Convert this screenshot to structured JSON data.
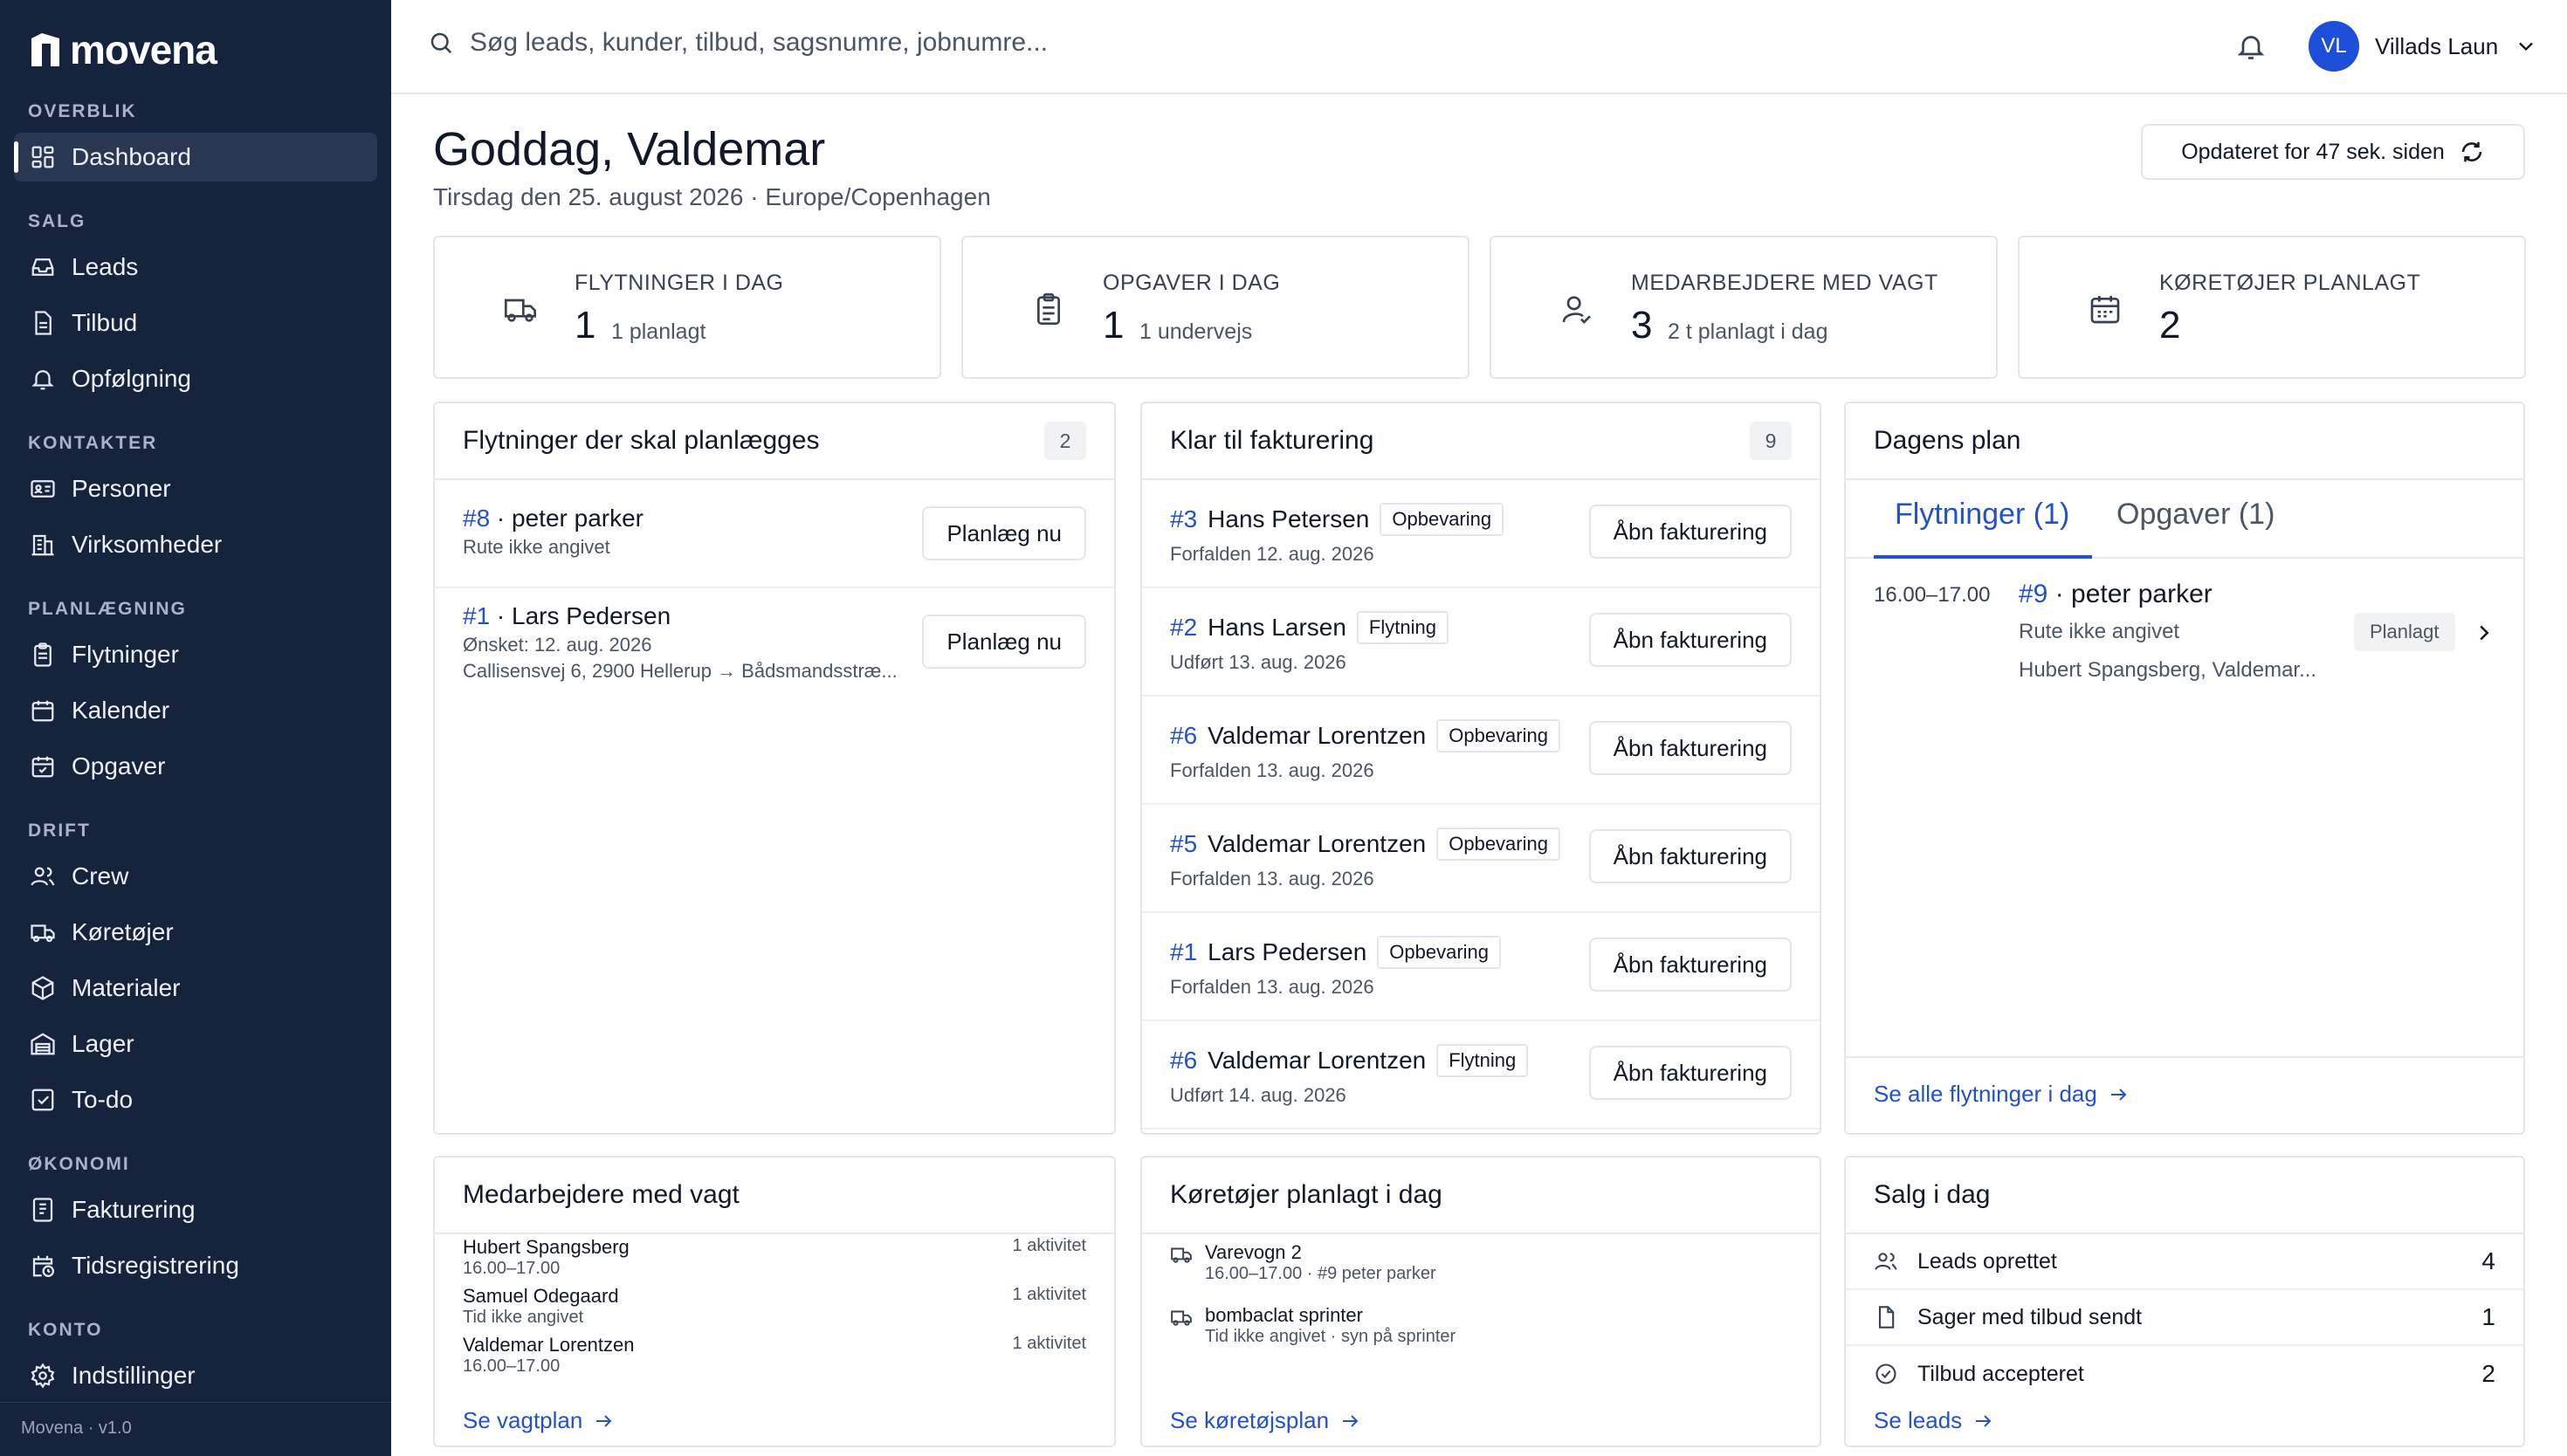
{
  "brand": {
    "name": "movena",
    "version": "Movena · v1.0"
  },
  "sidebar": {
    "sections": [
      {
        "title": "OVERBLIK",
        "items": [
          {
            "label": "Dashboard",
            "icon": "dashboard-icon",
            "active": true
          }
        ]
      },
      {
        "title": "SALG",
        "items": [
          {
            "label": "Leads",
            "icon": "inbox-icon"
          },
          {
            "label": "Tilbud",
            "icon": "document-icon"
          },
          {
            "label": "Opfølgning",
            "icon": "bell-icon"
          }
        ]
      },
      {
        "title": "KONTAKTER",
        "items": [
          {
            "label": "Personer",
            "icon": "id-card-icon"
          },
          {
            "label": "Virksomheder",
            "icon": "building-icon"
          }
        ]
      },
      {
        "title": "PLANLÆGNING",
        "items": [
          {
            "label": "Flytninger",
            "icon": "clipboard-icon"
          },
          {
            "label": "Kalender",
            "icon": "calendar-icon"
          },
          {
            "label": "Opgaver",
            "icon": "calendar-check-icon"
          }
        ]
      },
      {
        "title": "DRIFT",
        "items": [
          {
            "label": "Crew",
            "icon": "users-icon"
          },
          {
            "label": "Køretøjer",
            "icon": "truck-icon"
          },
          {
            "label": "Materialer",
            "icon": "box-icon"
          },
          {
            "label": "Lager",
            "icon": "warehouse-icon"
          },
          {
            "label": "To-do",
            "icon": "checkbox-icon"
          }
        ]
      },
      {
        "title": "ØKONOMI",
        "items": [
          {
            "label": "Fakturering",
            "icon": "invoice-icon"
          },
          {
            "label": "Tidsregistrering",
            "icon": "clock-calendar-icon"
          }
        ]
      },
      {
        "title": "KONTO",
        "items": [
          {
            "label": "Indstillinger",
            "icon": "gear-icon"
          }
        ]
      }
    ]
  },
  "topbar": {
    "search_placeholder": "Søg leads, kunder, tilbud, sagsnumre, jobnumre...",
    "user": {
      "initials": "VL",
      "name": "Villads Laun"
    }
  },
  "header": {
    "greeting": "Goddag, Valdemar",
    "subtitle": "Tirsdag den 25. august 2026 · Europe/Copenhagen",
    "refresh_label": "Opdateret for 47 sek. siden"
  },
  "kpis": [
    {
      "label": "FLYTNINGER I DAG",
      "value": "1",
      "sub": "1 planlagt",
      "icon": "truck-icon"
    },
    {
      "label": "OPGAVER I DAG",
      "value": "1",
      "sub": "1 undervejs",
      "icon": "clipboard-icon"
    },
    {
      "label": "MEDARBEJDERE MED VAGT",
      "value": "3",
      "sub": "2 t planlagt i dag",
      "icon": "user-check-icon"
    },
    {
      "label": "KØRETØJER PLANLAGT",
      "value": "2",
      "sub": "",
      "icon": "calendar-icon"
    }
  ],
  "planning": {
    "title": "Flytninger der skal planlægges",
    "count": "2",
    "rows": [
      {
        "num": "#8",
        "name": " · peter parker",
        "line2": "Rute ikke angivet",
        "line3": "",
        "button": "Planlæg nu"
      },
      {
        "num": "#1",
        "name": " · Lars Pedersen",
        "line2": "Ønsket: 12. aug. 2026",
        "line3": "Callisensvej 6, 2900 Hellerup → Bådsmandsstræ...",
        "button": "Planlæg nu"
      }
    ]
  },
  "billing": {
    "title": "Klar til fakturering",
    "count": "9",
    "rows": [
      {
        "num": "#3",
        "name": "Hans Petersen",
        "tag": "Opbevaring",
        "sub": "Forfalden 12. aug. 2026",
        "button": "Åbn fakturering"
      },
      {
        "num": "#2",
        "name": "Hans Larsen",
        "tag": "Flytning",
        "sub": "Udført 13. aug. 2026",
        "button": "Åbn fakturering"
      },
      {
        "num": "#6",
        "name": "Valdemar Lorentzen",
        "tag": "Opbevaring",
        "sub": "Forfalden 13. aug. 2026",
        "button": "Åbn fakturering"
      },
      {
        "num": "#5",
        "name": "Valdemar Lorentzen",
        "tag": "Opbevaring",
        "sub": "Forfalden 13. aug. 2026",
        "button": "Åbn fakturering"
      },
      {
        "num": "#1",
        "name": "Lars Pedersen",
        "tag": "Opbevaring",
        "sub": "Forfalden 13. aug. 2026",
        "button": "Åbn fakturering"
      },
      {
        "num": "#6",
        "name": "Valdemar Lorentzen",
        "tag": "Flytning",
        "sub": "Udført 14. aug. 2026",
        "button": "Åbn fakturering"
      }
    ]
  },
  "dayplan": {
    "title": "Dagens plan",
    "tabs": [
      "Flytninger (1)",
      "Opgaver (1)"
    ],
    "item": {
      "time": "16.00–17.00",
      "num": "#9",
      "name": " · peter parker",
      "route": "Rute ikke angivet",
      "crew": "Hubert Spangsberg, Valdemar...",
      "status": "Planlagt"
    },
    "link": "Se alle flytninger i dag"
  },
  "staff": {
    "title": "Medarbejdere med vagt",
    "rows": [
      {
        "name": "Hubert Spangsberg",
        "time": "16.00–17.00",
        "activity": "1 aktivitet"
      },
      {
        "name": "Samuel Odegaard",
        "time": "Tid ikke angivet",
        "activity": "1 aktivitet"
      },
      {
        "name": "Valdemar Lorentzen",
        "time": "16.00–17.00",
        "activity": "1 aktivitet"
      }
    ],
    "link": "Se vagtplan"
  },
  "vehicles": {
    "title": "Køretøjer planlagt i dag",
    "rows": [
      {
        "name": "Varevogn 2",
        "detail": "16.00–17.00 · #9 peter parker"
      },
      {
        "name": "bombaclat sprinter",
        "detail": "Tid ikke angivet · syn på sprinter"
      }
    ],
    "link": "Se køretøjsplan"
  },
  "sales": {
    "title": "Salg i dag",
    "rows": [
      {
        "label": "Leads oprettet",
        "value": "4",
        "icon": "users-icon"
      },
      {
        "label": "Sager med tilbud sendt",
        "value": "1",
        "icon": "document-icon"
      },
      {
        "label": "Tilbud accepteret",
        "value": "2",
        "icon": "check-circle-icon"
      }
    ],
    "link": "Se leads"
  },
  "colors": {
    "sidebar": "#16233d",
    "accent": "#2251cc",
    "avatar": "#1d4fd8"
  }
}
